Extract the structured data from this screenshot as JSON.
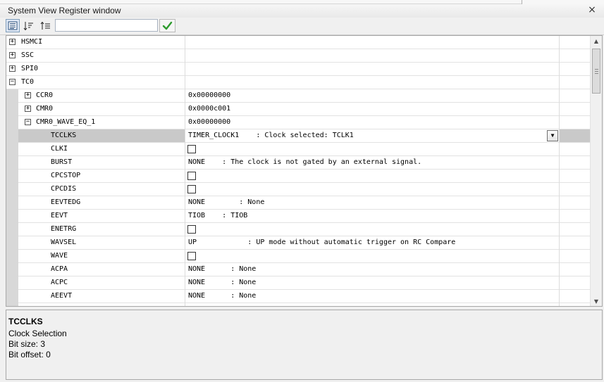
{
  "window": {
    "title": "System View Register window",
    "close_glyph": "×"
  },
  "toolbar": {
    "buttons": [
      {
        "name": "register-view-icon",
        "active": true
      },
      {
        "name": "sort-descending-icon",
        "active": false
      },
      {
        "name": "sort-tree-icon",
        "active": false
      }
    ],
    "filter_value": "",
    "apply_icon": "checkmark-icon",
    "apply_color": "#2e9b2e"
  },
  "rows": [
    {
      "name": "HSMCI",
      "level": 0,
      "expander": "+",
      "value": ""
    },
    {
      "name": "SSC",
      "level": 0,
      "expander": "+",
      "value": ""
    },
    {
      "name": "SPI0",
      "level": 0,
      "expander": "+",
      "value": ""
    },
    {
      "name": "TC0",
      "level": 0,
      "expander": "−",
      "value": ""
    },
    {
      "name": "CCR0",
      "level": 1,
      "expander": "+",
      "value": "0x00000000"
    },
    {
      "name": "CMR0",
      "level": 1,
      "expander": "+",
      "value": "0x0000c001"
    },
    {
      "name": "CMR0_WAVE_EQ_1",
      "level": 1,
      "expander": "−",
      "value": "0x00000000"
    },
    {
      "name": "TCCLKS",
      "level": 2,
      "value": "TIMER_CLOCK1    : Clock selected: TCLK1",
      "selected": true,
      "dropdown": true
    },
    {
      "name": "CLKI",
      "level": 2,
      "checkbox": true
    },
    {
      "name": "BURST",
      "level": 2,
      "value": "NONE    : The clock is not gated by an external signal."
    },
    {
      "name": "CPCSTOP",
      "level": 2,
      "checkbox": true
    },
    {
      "name": "CPCDIS",
      "level": 2,
      "checkbox": true
    },
    {
      "name": "EEVTEDG",
      "level": 2,
      "value": "NONE        : None"
    },
    {
      "name": "EEVT",
      "level": 2,
      "value": "TIOB    : TIOB"
    },
    {
      "name": "ENETRG",
      "level": 2,
      "checkbox": true
    },
    {
      "name": "WAVSEL",
      "level": 2,
      "value": "UP            : UP mode without automatic trigger on RC Compare"
    },
    {
      "name": "WAVE",
      "level": 2,
      "checkbox": true
    },
    {
      "name": "ACPA",
      "level": 2,
      "value": "NONE      : None"
    },
    {
      "name": "ACPC",
      "level": 2,
      "value": "NONE      : None"
    },
    {
      "name": "AEEVT",
      "level": 2,
      "value": "NONE      : None"
    },
    {
      "name": "",
      "level": 2,
      "value": ""
    }
  ],
  "scrollbar": {
    "up_glyph": "▲",
    "down_glyph": "▼"
  },
  "detail": {
    "title": "TCCLKS",
    "lines": [
      "Clock Selection",
      "Bit size: 3",
      "Bit offset: 0"
    ]
  },
  "dropdown_glyph": "▼"
}
